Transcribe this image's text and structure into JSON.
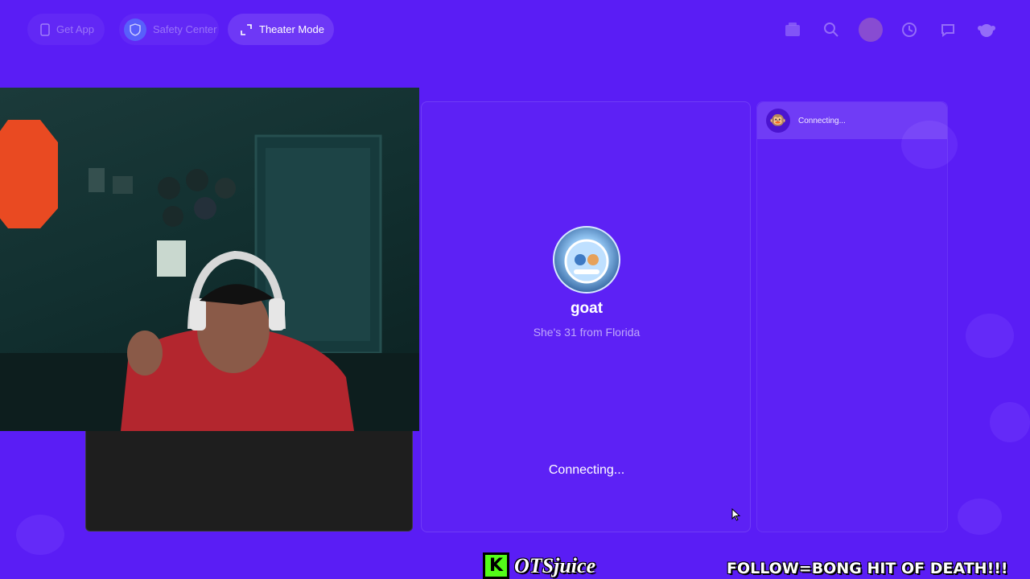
{
  "topbar": {
    "get_app": "Get App",
    "safety_center": "Safety Center",
    "theater_mode": "Theater Mode",
    "icons": [
      "free-badge-icon",
      "search-icon",
      "profile-avatar-icon",
      "history-clock-icon",
      "chat-bubble-icon",
      "monkey-logo-icon"
    ]
  },
  "stranger": {
    "name": "goat",
    "bio": "She's 31 from Florida",
    "status": "Connecting..."
  },
  "chat": {
    "status": "Connecting...",
    "avatar_emoji": "🐵"
  },
  "overlay": {
    "brand_letter": "K",
    "brand_name": "OTSjuice",
    "ticker": "FOLLOW=BONG HIT OF DEATH!!!"
  },
  "colors": {
    "background": "#5a1df5",
    "kick_green": "#53fc18"
  }
}
